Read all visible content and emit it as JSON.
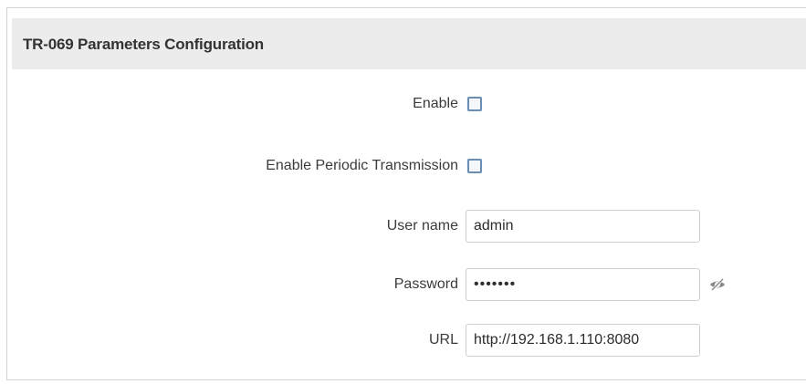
{
  "panel": {
    "title": "TR-069 Parameters Configuration"
  },
  "form": {
    "enable": {
      "label": "Enable",
      "checked": false
    },
    "periodic": {
      "label": "Enable Periodic Transmission",
      "checked": false
    },
    "username": {
      "label": "User name",
      "value": "admin"
    },
    "password": {
      "label": "Password",
      "value": "•••••••",
      "icon": "eye-slash-icon"
    },
    "url": {
      "label": "URL",
      "value": "http://192.168.1.110:8080"
    }
  },
  "colors": {
    "header_bg": "#ececec",
    "checkbox_border": "#6a8db3",
    "input_border": "#cfcfcf"
  }
}
